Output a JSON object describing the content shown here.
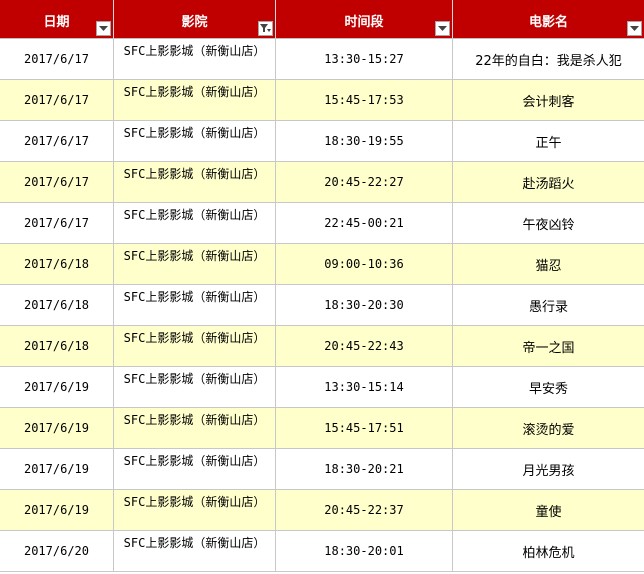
{
  "header": {
    "date": "日期",
    "cinema": "影院",
    "time": "时间段",
    "movie": "电影名"
  },
  "rows": [
    {
      "date": "2017/6/17",
      "cinema": "SFC上影影城（新衡山店）",
      "time": "13:30-15:27",
      "movie": "22年的自白：我是杀人犯"
    },
    {
      "date": "2017/6/17",
      "cinema": "SFC上影影城（新衡山店）",
      "time": "15:45-17:53",
      "movie": "会计刺客"
    },
    {
      "date": "2017/6/17",
      "cinema": "SFC上影影城（新衡山店）",
      "time": "18:30-19:55",
      "movie": "正午"
    },
    {
      "date": "2017/6/17",
      "cinema": "SFC上影影城（新衡山店）",
      "time": "20:45-22:27",
      "movie": "赴汤蹈火"
    },
    {
      "date": "2017/6/17",
      "cinema": "SFC上影影城（新衡山店）",
      "time": "22:45-00:21",
      "movie": "午夜凶铃"
    },
    {
      "date": "2017/6/18",
      "cinema": "SFC上影影城（新衡山店）",
      "time": "09:00-10:36",
      "movie": "猫忍"
    },
    {
      "date": "2017/6/18",
      "cinema": "SFC上影影城（新衡山店）",
      "time": "18:30-20:30",
      "movie": "愚行录"
    },
    {
      "date": "2017/6/18",
      "cinema": "SFC上影影城（新衡山店）",
      "time": "20:45-22:43",
      "movie": "帝一之国"
    },
    {
      "date": "2017/6/19",
      "cinema": "SFC上影影城（新衡山店）",
      "time": "13:30-15:14",
      "movie": "早安秀"
    },
    {
      "date": "2017/6/19",
      "cinema": "SFC上影影城（新衡山店）",
      "time": "15:45-17:51",
      "movie": "滚烫的爱"
    },
    {
      "date": "2017/6/19",
      "cinema": "SFC上影影城（新衡山店）",
      "time": "18:30-20:21",
      "movie": "月光男孩"
    },
    {
      "date": "2017/6/19",
      "cinema": "SFC上影影城（新衡山店）",
      "time": "20:45-22:37",
      "movie": "童使"
    },
    {
      "date": "2017/6/20",
      "cinema": "SFC上影影城（新衡山店）",
      "time": "18:30-20:01",
      "movie": "柏林危机"
    }
  ],
  "colors": {
    "header_bg": "#c00000",
    "band_odd": "#ffffff",
    "band_even": "#ffffcc"
  },
  "icons": {
    "dropdown": "dropdown-arrow-icon",
    "filter_active": "filter-funnel-icon"
  }
}
